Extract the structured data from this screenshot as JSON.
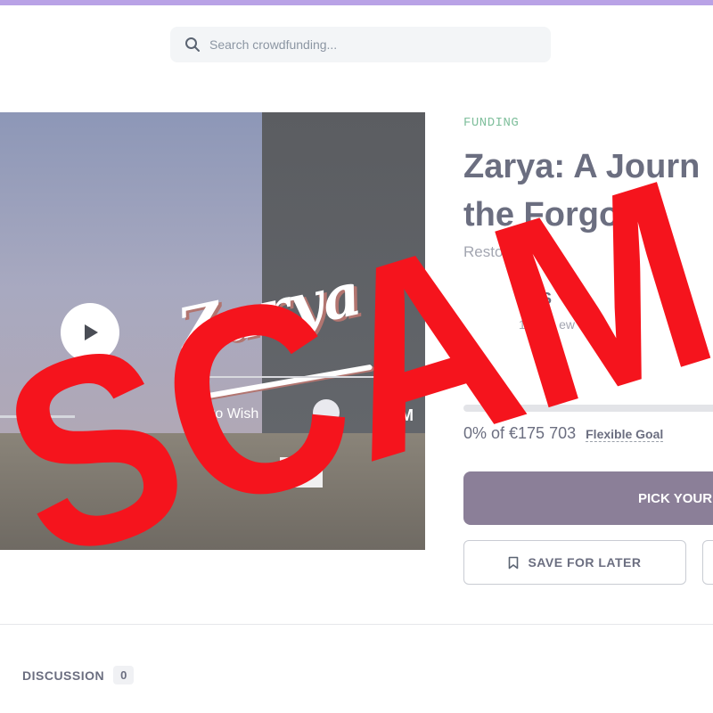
{
  "colors": {
    "accent_bar": "#b9a2e6",
    "funding_tag": "#7fbf9c",
    "primary_button": "#8b7f98",
    "scam_overlay": "#f5141d",
    "progress_fill": "#6fbf95"
  },
  "header": {
    "search_placeholder": "Search crowdfunding...",
    "search_icon": "search-icon",
    "nav_icon": "chevron-right-icon"
  },
  "media": {
    "logo_text": "Zarya",
    "wishlist_text": "Add to Wish",
    "trailing_letter": "M",
    "brand_badge": "SBSR",
    "play_icon": "play-icon"
  },
  "campaign": {
    "tag": "FUNDING",
    "title_line1": "Zarya: A Journ",
    "title_line2": "the Forgot",
    "subtitle": "Restore th          e t",
    "creator_name": "SBS",
    "creator_meta": "1 Cam          ew      St",
    "progress_percent": 0,
    "funding_percent_text": "0% of €175 703",
    "goal_type": "Flexible Goal",
    "pick_button": "PICK YOUR",
    "save_button": "SAVE FOR LATER",
    "save_icon": "bookmark-icon"
  },
  "tabs": {
    "discussion_label": "DISCUSSION",
    "discussion_count": "0"
  },
  "overlay": {
    "text": "SCAM"
  }
}
